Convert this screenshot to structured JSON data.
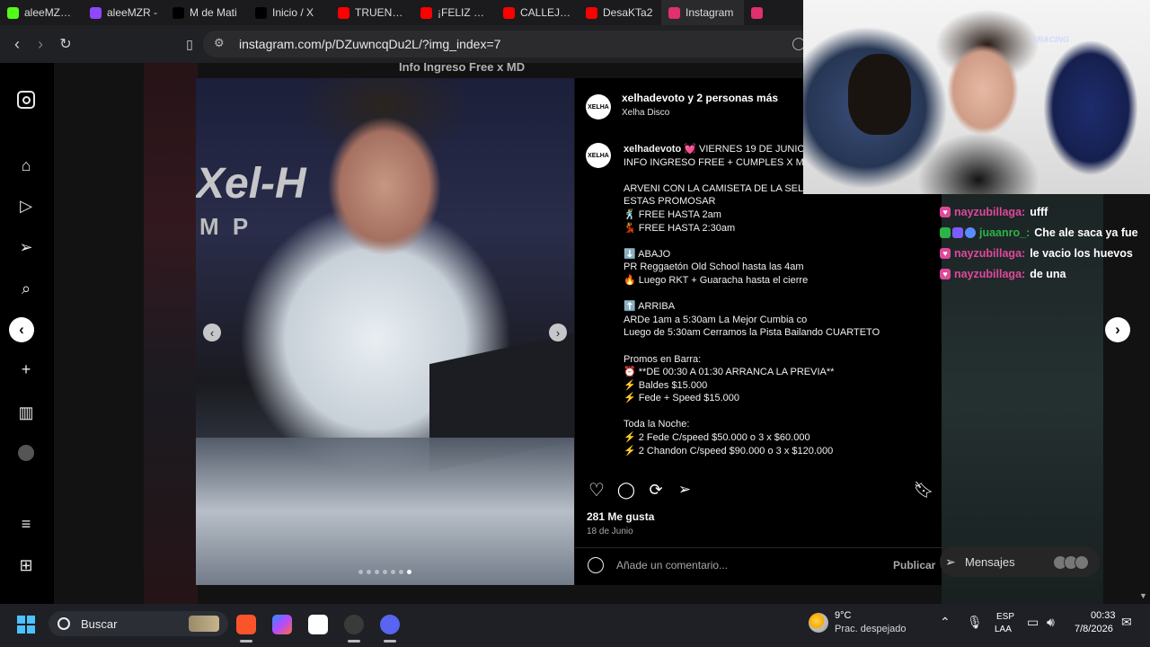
{
  "tabs": [
    {
      "label": "aleeMZR S",
      "icon": "kick-icon",
      "color": "#53fc18"
    },
    {
      "label": "aleeMZR -",
      "icon": "twitch-icon",
      "color": "#9146ff"
    },
    {
      "label": "M de Mati",
      "icon": "x-icon",
      "color": "#000000"
    },
    {
      "label": "Inicio / X",
      "icon": "x-icon",
      "color": "#000000"
    },
    {
      "label": "TRUENO -",
      "icon": "youtube-icon",
      "color": "#ff0000"
    },
    {
      "label": "¡FELIZ CUM",
      "icon": "youtube-icon",
      "color": "#ff0000"
    },
    {
      "label": "CALLEJERO",
      "icon": "youtube-icon",
      "color": "#ff0000"
    },
    {
      "label": "DesaKTa2",
      "icon": "youtube-icon",
      "color": "#ff0000"
    },
    {
      "label": "Instagram",
      "icon": "instagram-icon",
      "color": "#e1306c",
      "active": true
    },
    {
      "label": "",
      "icon": "instagram-icon",
      "color": "#e1306c"
    }
  ],
  "address_bar": {
    "url": "instagram.com/p/DZuwncqDu2L/?img_index=7"
  },
  "background": {
    "top_text": "Info Ingreso Free x MD"
  },
  "photo": {
    "overlay_text": "Xel-H",
    "overlay_sub": "M P",
    "dots_total": 7,
    "dots_active_index": 6
  },
  "post": {
    "header": {
      "username": "xelhadevoto y 2 personas más",
      "location": "Xelha Disco"
    },
    "caption_user": "xelhadevoto",
    "caption_lines": [
      " 💓 VIERNES 19 DE JUNIO",
      "INFO INGRESO FREE + CUMPLES X MD",
      "",
      "ARVENI CON LA CAMISETA DE LA SELEC",
      "ESTAS PROMOSAR",
      "🕺 FREE HASTA 2am",
      "💃 FREE HASTA 2:30am",
      "",
      "⬇️ ABAJO",
      "PR Reggaetón Old School hasta las 4am",
      "🔥 Luego RKT + Guaracha hasta el cierre",
      "",
      "⬆️ ARRIBA",
      "ARDe 1am a 5:30am La Mejor Cumbia co",
      "Luego de 5:30am Cerramos la Pista Bailando CUARTETO",
      "",
      "Promos en Barra:",
      "⏰ **DE 00:30 A 01:30 ARRANCA LA PREVIA**",
      "⚡ Baldes $15.000",
      "⚡ Fede + Speed $15.000",
      "",
      "Toda la Noche:",
      "⚡ 2 Fede C/speed $50.000 o 3 x $60.000",
      "⚡ 2 Chandon C/speed $90.000 o 3 x $120.000"
    ],
    "likes": "281 Me gusta",
    "date": "18 de Junio",
    "comment_placeholder": "Añade un comentario...",
    "publish_label": "Publicar"
  },
  "messages": {
    "label": "Mensajes"
  },
  "chat": [
    {
      "user": "nayzubillaga:",
      "message": "ufff",
      "user_color": "#e0489b",
      "badges": "heart"
    },
    {
      "user": "juaanro_:",
      "message": "Che ale saca ya fue",
      "user_color": "#2bb34a",
      "badges": "multi"
    },
    {
      "user": "nayzubillaga:",
      "message": "le vacio los huevos",
      "user_color": "#e0489b",
      "badges": "heart"
    },
    {
      "user": "nayzubillaga:",
      "message": "de una",
      "user_color": "#e0489b",
      "badges": "heart"
    }
  ],
  "webcam": {
    "chair_brand": "KRACING"
  },
  "taskbar": {
    "search_label": "Buscar",
    "weather_temp": "9°C",
    "weather_desc": "Prac. despejado",
    "lang_line1": "ESP",
    "lang_line2": "LAA",
    "time": "00:33",
    "date": "7/8/2026"
  }
}
